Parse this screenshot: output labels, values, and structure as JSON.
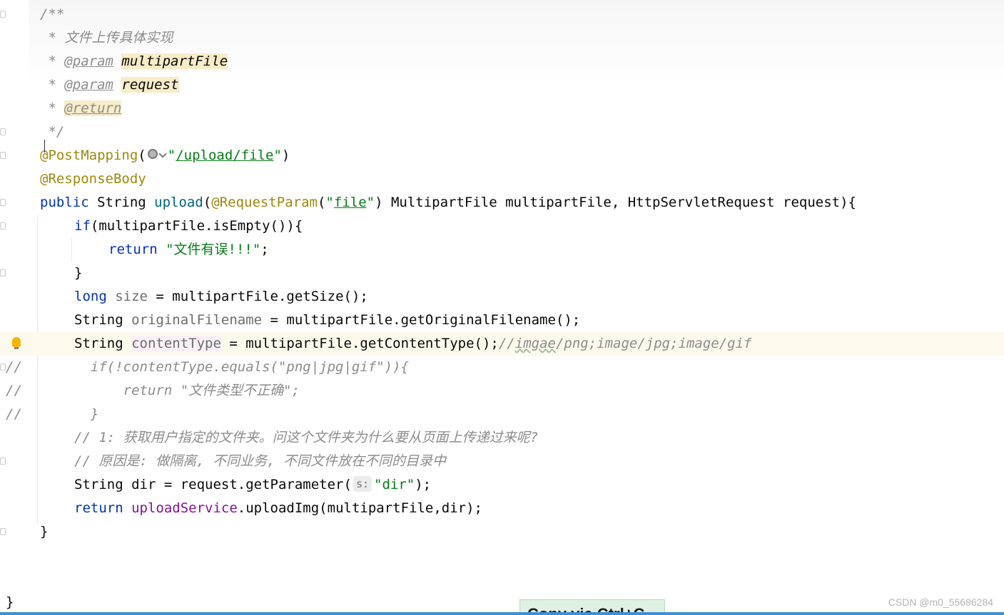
{
  "lines": {
    "l1": "/**",
    "l2_star": " * ",
    "l2_text": "文件上传具体实现",
    "l3_star": " * ",
    "l3_tag": "@param",
    "l3_name": "multipartFile",
    "l4_star": " * ",
    "l4_tag": "@param",
    "l4_name": "request",
    "l5_star": " * ",
    "l5_tag": "@return",
    "l6": " */",
    "l7_anno": "@PostMapping",
    "l7_open": "(",
    "l7_str_q1": "\"",
    "l7_str_path": "/upload/file",
    "l7_str_q2": "\"",
    "l7_close": ")",
    "l8_anno": "@ResponseBody",
    "l9_kw": "public",
    "l9_type": " String ",
    "l9_method": "upload",
    "l9_open": "(",
    "l9_anno": "@RequestParam",
    "l9_p_open": "(",
    "l9_q1": "\"",
    "l9_file": "file",
    "l9_q2": "\"",
    "l9_rest": ") MultipartFile multipartFile, HttpServletRequest request){",
    "l10_kw": "if",
    "l10_rest": "(multipartFile.isEmpty()){",
    "l11_kw": "return",
    "l11_str": " \"文件有误!!!\"",
    "l11_end": ";",
    "l12": "}",
    "l13_kw": "long",
    "l13_var": " size",
    "l13_rest": " = multipartFile.getSize();",
    "l14_type": "String ",
    "l14_var": "originalFilename",
    "l14_rest": " = multipartFile.getOriginalFilename();",
    "l15_type": "String ",
    "l15_var": "contentType",
    "l15_rest": " = multipartFile.getContentType();",
    "l15_comment_a": "//",
    "l15_comment_b": "imgae",
    "l15_comment_c": "/png;image/jpg;image/gif",
    "l16_slash": "//",
    "l16_code": "  if(!contentType.equals(\"png|jpg|gif\")){",
    "l17_slash": "//",
    "l17_code": "      return \"文件类型不正确\";",
    "l18_slash": "//",
    "l18_code": "  }",
    "l19": "// 1: 获取用户指定的文件夹。问这个文件夹为什么要从页面上传递过来呢?",
    "l20": "// 原因是: 做隔离, 不同业务, 不同文件放在不同的目录中",
    "l21_a": "String dir = request.getParameter(",
    "l21_hint": "s:",
    "l21_str": "\"dir\"",
    "l21_end": ");",
    "l22_kw": "return",
    "l22_field": " uploadService",
    "l22_rest": ".uploadImg(multipartFile,dir);",
    "l23": "}",
    "l24": "}"
  },
  "tooltip": "Copy via Ctrl+C",
  "watermark": "CSDN @m0_55686284",
  "icons": {
    "bulb": "lightbulb-icon",
    "globe": "globe-icon"
  }
}
